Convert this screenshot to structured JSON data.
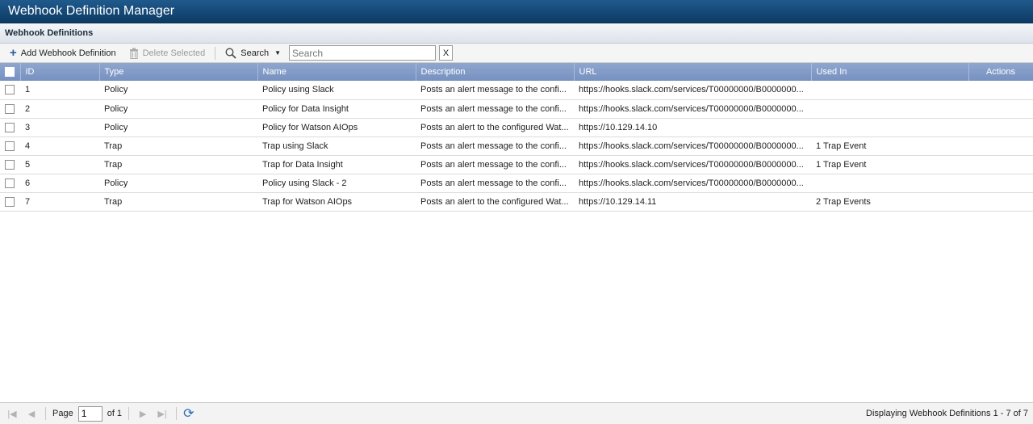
{
  "app": {
    "title": "Webhook Definition Manager"
  },
  "panel": {
    "title": "Webhook Definitions"
  },
  "toolbar": {
    "add_label": "Add Webhook Definition",
    "delete_label": "Delete Selected",
    "search_label": "Search",
    "search_placeholder": "Search",
    "clear_label": "X"
  },
  "columns": {
    "id": "ID",
    "type": "Type",
    "name": "Name",
    "description": "Description",
    "url": "URL",
    "used_in": "Used In",
    "actions": "Actions"
  },
  "rows": [
    {
      "id": "1",
      "type": "Policy",
      "name": "Policy using Slack",
      "description": "Posts an alert message to the confi...",
      "url": "https://hooks.slack.com/services/T00000000/B0000000...",
      "used_in": ""
    },
    {
      "id": "2",
      "type": "Policy",
      "name": "Policy for Data Insight",
      "description": "Posts an alert message to the confi...",
      "url": "https://hooks.slack.com/services/T00000000/B0000000...",
      "used_in": ""
    },
    {
      "id": "3",
      "type": "Policy",
      "name": "Policy for Watson AIOps",
      "description": "Posts an alert to the configured Wat...",
      "url": "https://10.129.14.10",
      "used_in": ""
    },
    {
      "id": "4",
      "type": "Trap",
      "name": "Trap using Slack",
      "description": "Posts an alert message to the confi...",
      "url": "https://hooks.slack.com/services/T00000000/B0000000...",
      "used_in": "1 Trap Event"
    },
    {
      "id": "5",
      "type": "Trap",
      "name": "Trap for Data Insight",
      "description": "Posts an alert message to the confi...",
      "url": "https://hooks.slack.com/services/T00000000/B0000000...",
      "used_in": "1 Trap Event"
    },
    {
      "id": "6",
      "type": "Policy",
      "name": "Policy using Slack - 2",
      "description": "Posts an alert message to the confi...",
      "url": "https://hooks.slack.com/services/T00000000/B0000000...",
      "used_in": ""
    },
    {
      "id": "7",
      "type": "Trap",
      "name": "Trap for Watson AIOps",
      "description": "Posts an alert to the configured Wat...",
      "url": "https://10.129.14.11",
      "used_in": "2 Trap Events"
    }
  ],
  "paging": {
    "page_label": "Page",
    "page_value": "1",
    "of_label": "of 1",
    "status": "Displaying Webhook Definitions 1 - 7 of 7"
  }
}
